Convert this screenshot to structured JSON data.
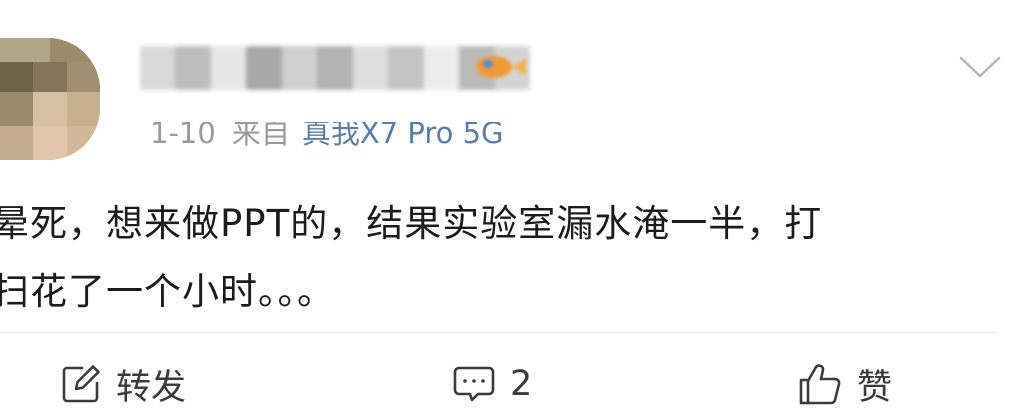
{
  "post": {
    "meta": {
      "date": "1-10",
      "source_label": "来自",
      "device": "真我X7 Pro 5G"
    },
    "content": "晕死，想来做PPT的，结果实验室漏水淹一半，打\n扫花了一个小时。。。"
  },
  "actions": {
    "repost_label": "转发",
    "comment_count": "2",
    "like_label": "赞"
  },
  "icons": {
    "more": "chevron-down-icon",
    "repost": "edit-square-icon",
    "comment": "comment-bubble-icon",
    "like": "thumbs-up-icon"
  },
  "colors": {
    "text": "#1c1c1c",
    "meta_gray": "#9a9a9a",
    "device_blue": "#5a7ea6",
    "action_gray": "#3b3b3b",
    "divider": "#e8e8e8"
  }
}
